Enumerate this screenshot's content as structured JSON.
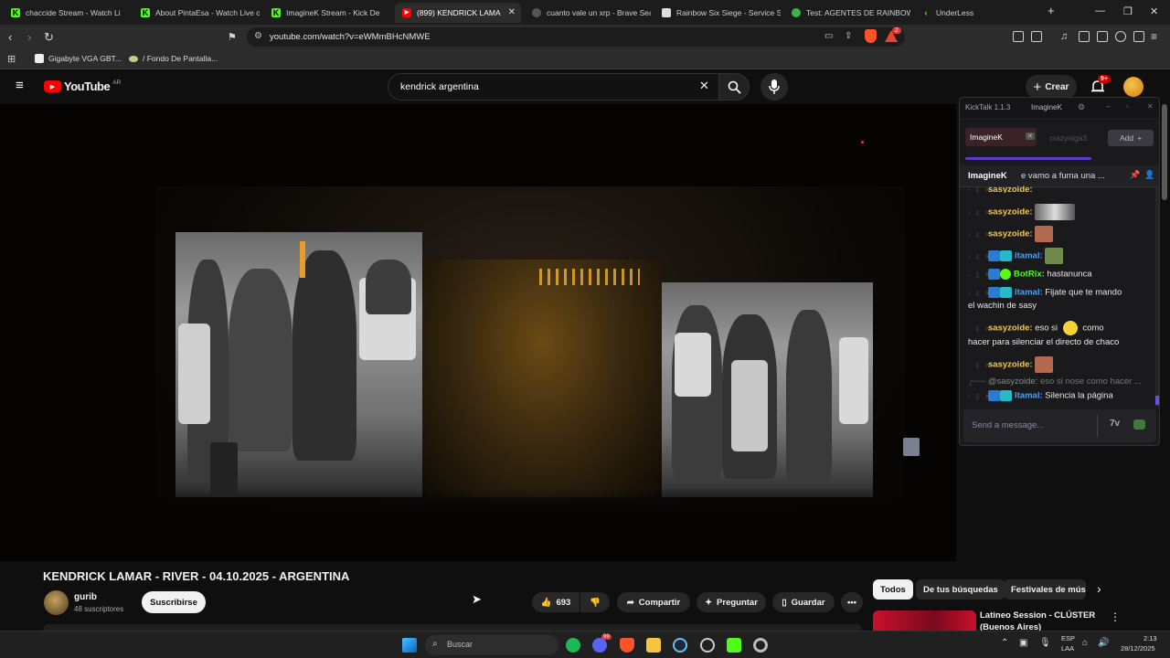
{
  "browser": {
    "tabs": [
      {
        "label": "chaccide Stream - Watch Li",
        "icon": "kick-icon"
      },
      {
        "label": "About PintaEsa - Watch Live on",
        "icon": "kick-icon"
      },
      {
        "label": "ImagineK Stream - Kick De",
        "icon": "kick-icon"
      },
      {
        "label": "(899) KENDRICK LAMA",
        "icon": "youtube-icon"
      },
      {
        "label": "cuanto vale un xrp - Brave Sea",
        "icon": "brave-search-icon"
      },
      {
        "label": "Rainbow Six Siege - Service St",
        "icon": "doc-icon"
      },
      {
        "label": "Test: AGENTES DE RAINBOW S",
        "icon": "test-icon"
      },
      {
        "label": "UnderLess",
        "icon": "kick-icon"
      }
    ],
    "url": "youtube.com/watch?v=eWMmBHcNMWE",
    "bookmarks": [
      "Gigabyte VGA GBT...",
      "/ Fondo De Pantalla..."
    ],
    "shield_badge": "2"
  },
  "youtube": {
    "logo": "YouTube",
    "region": "AR",
    "search_value": "kendrick argentina",
    "create_label": "Crear",
    "notif_count": "9+",
    "video_title": "KENDRICK LAMAR - RIVER - 04.10.2025 - ARGENTINA",
    "channel_name": "gurib",
    "subscribers": "48 suscriptores",
    "subscribe_label": "Suscribirse",
    "likes": "693",
    "share_label": "Compartir",
    "ask_label": "Preguntar",
    "save_label": "Guardar",
    "chips": [
      "Todos",
      "De tus búsquedas",
      "Festivales de músic"
    ],
    "rec_title_1": "Latineo Session - CLÚSTER",
    "rec_title_2": "(Buenos Aires)"
  },
  "kicktalk": {
    "app_title": "KickTalk 1.1.3",
    "user": "ImagineK",
    "tabs": [
      "ImagineK",
      "crazyniga3"
    ],
    "add_label": "Add",
    "pinned_user": "ImagineK",
    "pinned_text": "e vamo a fuma una ...",
    "messages": [
      {
        "user": "sasyzoide:",
        "text": "",
        "color": "#f2c94c"
      },
      {
        "user": "sasyzoide:",
        "text": "",
        "color": "#f2c94c"
      },
      {
        "user": "sasyzoide:",
        "text": "",
        "color": "#f2c94c"
      },
      {
        "user": "itamal:",
        "text": "",
        "color": "#4aa3ff"
      },
      {
        "user": "BotRix:",
        "text": "hastanunca",
        "color": "#53fc18"
      },
      {
        "user": "itamal:",
        "text": "Fijate que te mando",
        "cont": "el wachin de sasy",
        "color": "#4aa3ff"
      },
      {
        "user": "sasyzoide:",
        "text": "eso si",
        "text2": "como",
        "cont": "hacer para silenciar el directo de chaco",
        "color": "#f2c94c"
      },
      {
        "user": "sasyzoide:",
        "text": "",
        "color": "#f2c94c"
      },
      {
        "user": "@sasyzoide:",
        "text": "eso si nose como hacer ...",
        "color": "#888888"
      },
      {
        "user": "itamal:",
        "text": "Silencia la página",
        "color": "#4aa3ff"
      }
    ],
    "input_placeholder": "Send a message..."
  },
  "taskbar": {
    "search_placeholder": "Buscar",
    "lang_1": "ESP",
    "lang_2": "LAA",
    "time": "2:13",
    "date": "28/12/2025",
    "discord_badge": "99"
  },
  "colors": {
    "accent_red": "#ff0000",
    "kick_green": "#53fc18",
    "bg": "#0f0f0f"
  }
}
